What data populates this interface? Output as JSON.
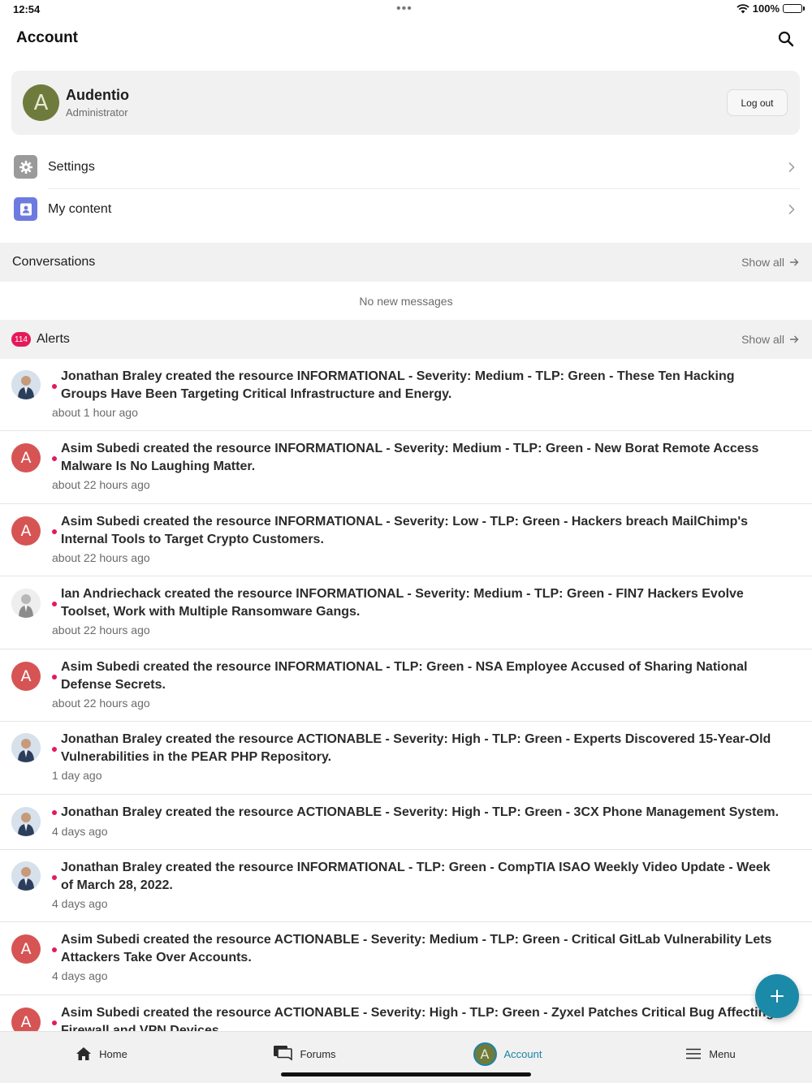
{
  "status_bar": {
    "time": "12:54",
    "dots": "•••",
    "battery": "100%"
  },
  "header": {
    "title": "Account"
  },
  "profile": {
    "avatar_letter": "A",
    "name": "Audentio",
    "role": "Administrator",
    "logout_label": "Log out"
  },
  "menu": [
    {
      "label": "Settings",
      "icon": "gear-icon",
      "color": "#9a9a9a"
    },
    {
      "label": "My content",
      "icon": "contact-card-icon",
      "color": "#6d7ae0"
    }
  ],
  "conversations": {
    "title": "Conversations",
    "show_all": "Show all",
    "empty": "No new messages"
  },
  "alerts": {
    "title": "Alerts",
    "badge": "114",
    "show_all": "Show all",
    "items": [
      {
        "avatar": "photo",
        "text": "Jonathan Braley created the resource INFORMATIONAL - Severity: Medium - TLP: Green - These Ten Hacking Groups Have Been Targeting Critical Infrastructure and Energy.",
        "time": "about 1 hour ago"
      },
      {
        "avatar": "A",
        "text": "Asim Subedi created the resource INFORMATIONAL - Severity: Medium - TLP: Green - New Borat Remote Access Malware Is No Laughing Matter.",
        "time": "about 22 hours ago"
      },
      {
        "avatar": "A",
        "text": "Asim Subedi created the resource INFORMATIONAL - Severity: Low - TLP: Green - Hackers breach MailChimp's Internal Tools to Target Crypto Customers.",
        "time": "about 22 hours ago"
      },
      {
        "avatar": "photo-gray",
        "text": "Ian Andriechack created the resource INFORMATIONAL - Severity: Medium - TLP: Green - FIN7 Hackers Evolve Toolset, Work with Multiple Ransomware Gangs.",
        "time": "about 22 hours ago"
      },
      {
        "avatar": "A",
        "text": "Asim Subedi created the resource INFORMATIONAL - TLP: Green - NSA Employee Accused of Sharing National Defense Secrets.",
        "time": "about 22 hours ago"
      },
      {
        "avatar": "photo",
        "text": "Jonathan Braley created the resource ACTIONABLE - Severity: High - TLP: Green - Experts Discovered 15-Year-Old Vulnerabilities in the PEAR PHP Repository.",
        "time": "1 day ago"
      },
      {
        "avatar": "photo",
        "text": "Jonathan Braley created the resource ACTIONABLE - Severity: High - TLP: Green - 3CX Phone Management System.",
        "time": "4 days ago"
      },
      {
        "avatar": "photo",
        "text": "Jonathan Braley created the resource INFORMATIONAL - TLP: Green - CompTIA ISAO Weekly Video Update - Week of March 28, 2022.",
        "time": "4 days ago"
      },
      {
        "avatar": "A",
        "text": "Asim Subedi created the resource ACTIONABLE - Severity: Medium - TLP: Green - Critical GitLab Vulnerability Lets Attackers Take Over Accounts.",
        "time": "4 days ago"
      },
      {
        "avatar": "A",
        "text": "Asim Subedi created the resource ACTIONABLE - Severity: High - TLP: Green - Zyxel Patches Critical Bug Affecting Firewall and VPN Devices",
        "time": ""
      }
    ]
  },
  "fab": {
    "icon": "plus-icon"
  },
  "tabs": [
    {
      "label": "Home",
      "icon": "home-icon"
    },
    {
      "label": "Forums",
      "icon": "forums-icon"
    },
    {
      "label": "Account",
      "icon": "avatar",
      "avatar_letter": "A",
      "active": true
    },
    {
      "label": "Menu",
      "icon": "hamburger-icon"
    }
  ],
  "colors": {
    "accent": "#1b84a6",
    "badge": "#e5195a",
    "avatar_letter_bg": "#d75454",
    "profile_avatar_bg": "#6e7b3c"
  }
}
